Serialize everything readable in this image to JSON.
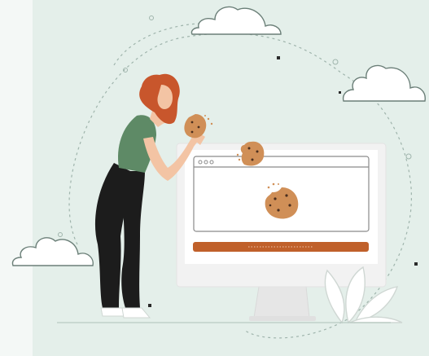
{
  "illustration": {
    "description_id": "cookie-consent-illustration",
    "colors": {
      "background": "#e4efea",
      "cloud_fill": "#ffffff",
      "cloud_stroke": "#6b7f78",
      "dots": "#2a2a2a",
      "dashed_path": "#9fb4ac",
      "monitor_frame": "#f2f2f2",
      "monitor_screen": "#ffffff",
      "window_outline": "#8a8a8a",
      "accept_bar": "#c0602a",
      "cookie": "#d08f57",
      "cookie_chip": "#4a2e1e",
      "hair": "#c8562c",
      "skin": "#f3c4a4",
      "shirt": "#5e8a66",
      "pants": "#1c1c1c",
      "shoes": "#ffffff",
      "leaves_stroke": "#cfd7d3"
    }
  }
}
